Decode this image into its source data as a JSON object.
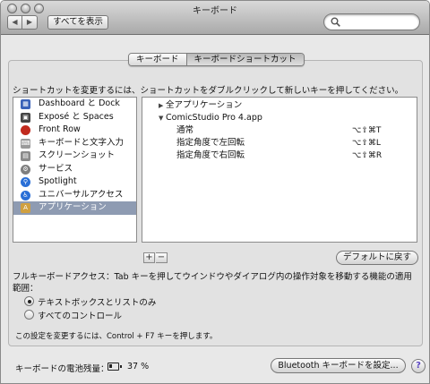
{
  "window": {
    "title": "キーボード",
    "show_all_label": "すべてを表示",
    "search_placeholder": ""
  },
  "tabs": [
    {
      "label": "キーボード",
      "active": false
    },
    {
      "label": "キーボードショートカット",
      "active": true
    }
  ],
  "instruction": "ショートカットを変更するには、ショートカットをダブルクリックして新しいキーを押してください。",
  "categories": [
    {
      "label": "Dashboard と Dock",
      "icon": "dashboard-icon",
      "color": "#3a62b8"
    },
    {
      "label": "Exposé と Spaces",
      "icon": "expose-icon",
      "color": "#454545"
    },
    {
      "label": "Front Row",
      "icon": "front-row-icon",
      "color": "#c12a1e"
    },
    {
      "label": "キーボードと文字入力",
      "icon": "keyboard-icon",
      "color": "#9a9a9a"
    },
    {
      "label": "スクリーンショット",
      "icon": "screenshot-icon",
      "color": "#8a8a8a"
    },
    {
      "label": "サービス",
      "icon": "gear-icon",
      "color": "#7f7f7f"
    },
    {
      "label": "Spotlight",
      "icon": "spotlight-icon",
      "color": "#2a6fd6"
    },
    {
      "label": "ユニバーサルアクセス",
      "icon": "universal-access-icon",
      "color": "#2a6fd6"
    },
    {
      "label": "アプリケーション",
      "icon": "applications-icon",
      "color": "#d0a040",
      "selected": true
    }
  ],
  "shortcuts": {
    "all_apps_label": "全アプリケーション",
    "app_label": "ComicStudio Pro 4.app",
    "items": [
      {
        "label": "通常",
        "keys": "⌥⇧⌘T"
      },
      {
        "label": "指定角度で左回転",
        "keys": "⌥⇧⌘L"
      },
      {
        "label": "指定角度で右回転",
        "keys": "⌥⇧⌘R"
      }
    ]
  },
  "buttons": {
    "add": "+",
    "remove": "−",
    "restore_defaults": "デフォルトに戻す",
    "bluetooth": "Bluetooth キーボードを設定...",
    "help": "?"
  },
  "full_keyboard": {
    "description": "フルキーボードアクセス：Tab キーを押してウインドウやダイアログ内の操作対象を移動する機能の適用範囲：",
    "options": [
      {
        "label": "テキストボックスとリストのみ",
        "selected": true
      },
      {
        "label": "すべてのコントロール",
        "selected": false
      }
    ],
    "note": "この設定を変更するには、Control + F7 キーを押します。"
  },
  "battery": {
    "label": "キーボードの電池残量：",
    "percent": "37 %",
    "level": 0.37
  }
}
